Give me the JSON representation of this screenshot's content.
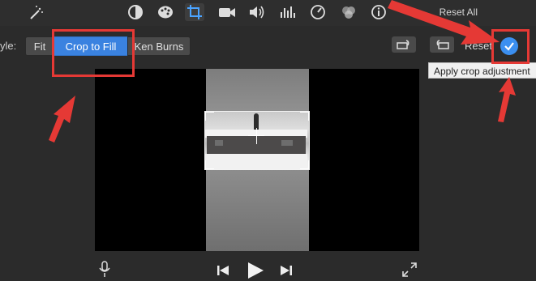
{
  "toolbar": {
    "icons": [
      "magic-wand-icon",
      "color-balance-icon",
      "palette-icon",
      "crop-icon",
      "camera-icon",
      "volume-icon",
      "equalizer-icon",
      "speed-icon",
      "filter-icon",
      "info-icon"
    ],
    "reset_all": "Reset All"
  },
  "style_row": {
    "label": "yle:",
    "options": [
      "Fit",
      "Crop to Fill",
      "Ken Burns"
    ],
    "selected": "Crop to Fill",
    "reset": "Reset"
  },
  "tooltip": "Apply crop adjustment",
  "colors": {
    "accent": "#3a82e0",
    "annotation": "#e53935"
  },
  "controls": [
    "microphone-icon",
    "skip-back-icon",
    "play-icon",
    "skip-forward-icon",
    "fullscreen-icon"
  ]
}
